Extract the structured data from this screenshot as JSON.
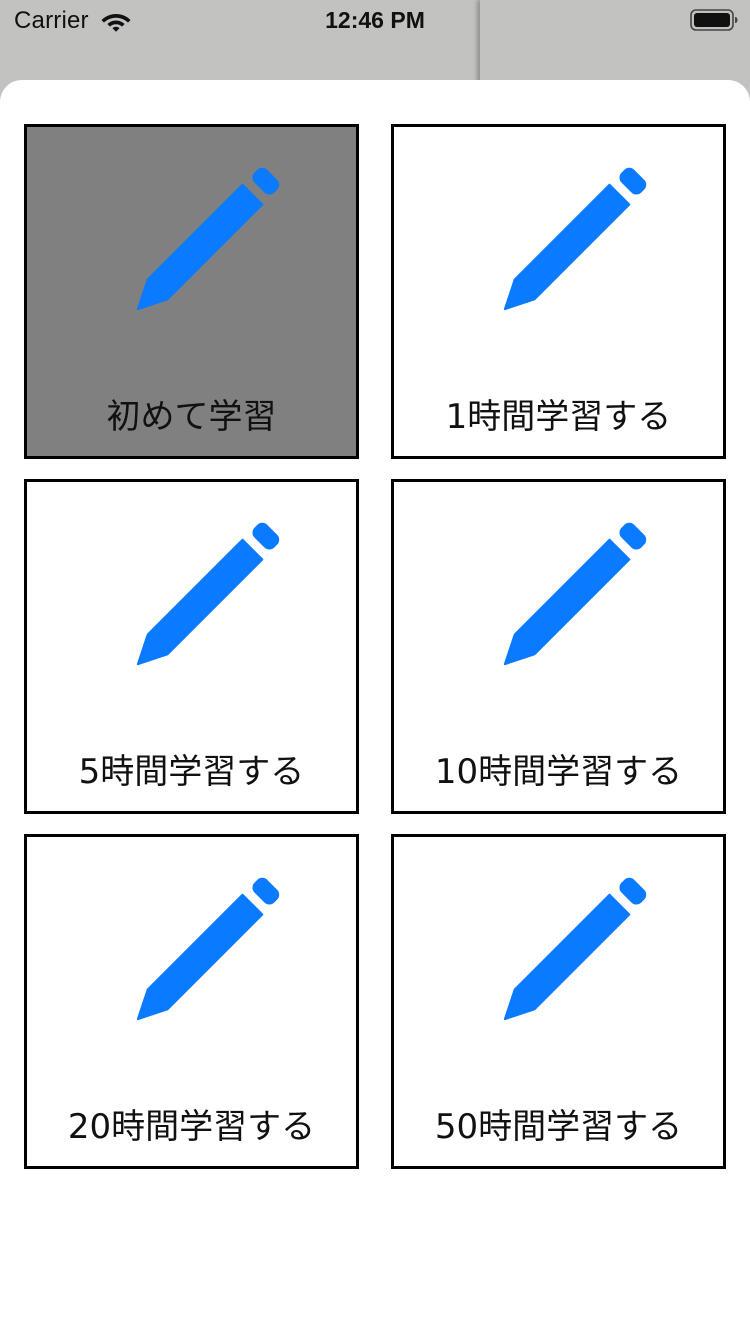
{
  "status_bar": {
    "carrier": "Carrier",
    "time": "12:46 PM",
    "wifi_icon": "wifi-icon",
    "battery_icon": "battery-icon"
  },
  "colors": {
    "accent": "#0a7aff",
    "selected_background": "#808080",
    "tile_border": "#000000"
  },
  "options": [
    {
      "label": "初めて学習",
      "icon": "pencil-icon",
      "selected": true
    },
    {
      "label": "1時間学習する",
      "icon": "pencil-icon",
      "selected": false
    },
    {
      "label": "5時間学習する",
      "icon": "pencil-icon",
      "selected": false
    },
    {
      "label": "10時間学習する",
      "icon": "pencil-icon",
      "selected": false
    },
    {
      "label": "20時間学習する",
      "icon": "pencil-icon",
      "selected": false
    },
    {
      "label": "50時間学習する",
      "icon": "pencil-icon",
      "selected": false
    }
  ]
}
